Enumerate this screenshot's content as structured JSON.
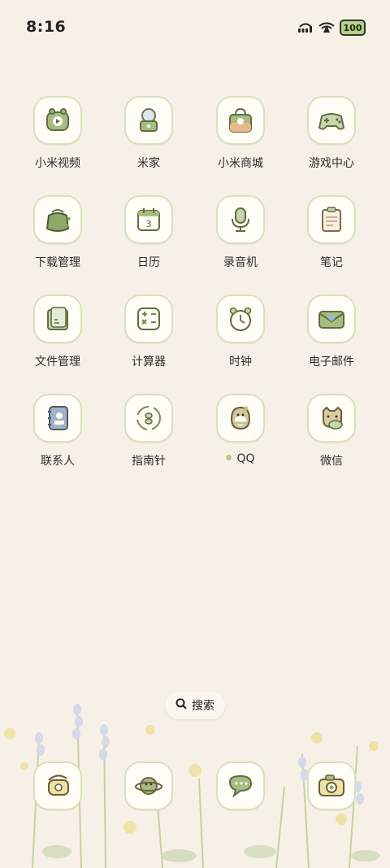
{
  "status_bar": {
    "time": "8:16",
    "battery": "100",
    "icons": [
      "signal-icon",
      "wifi-icon",
      "battery-icon"
    ]
  },
  "apps": [
    {
      "label": "小米视频",
      "icon": "video-icon"
    },
    {
      "label": "米家",
      "icon": "mijia-icon"
    },
    {
      "label": "小米商城",
      "icon": "store-bag-icon"
    },
    {
      "label": "游戏中心",
      "icon": "gamepad-icon"
    },
    {
      "label": "下载管理",
      "icon": "download-bag-icon"
    },
    {
      "label": "日历",
      "icon": "calendar-icon",
      "calendar_number": "3"
    },
    {
      "label": "录音机",
      "icon": "microphone-icon"
    },
    {
      "label": "笔记",
      "icon": "notepad-icon"
    },
    {
      "label": "文件管理",
      "icon": "folder-icon"
    },
    {
      "label": "计算器",
      "icon": "calculator-icon"
    },
    {
      "label": "时钟",
      "icon": "clock-icon"
    },
    {
      "label": "电子邮件",
      "icon": "mail-envelope-icon"
    },
    {
      "label": "联系人",
      "icon": "contacts-book-icon"
    },
    {
      "label": "指南针",
      "icon": "compass-icon"
    },
    {
      "label": "QQ",
      "icon": "qq-penguin-icon",
      "has_new_dot": true
    },
    {
      "label": "微信",
      "icon": "wechat-icon"
    }
  ],
  "search": {
    "label": "搜索",
    "icon": "search-icon"
  },
  "dock": [
    {
      "icon": "phone-icon"
    },
    {
      "icon": "browser-planet-icon"
    },
    {
      "icon": "messages-bubble-icon"
    },
    {
      "icon": "camera-icon"
    }
  ],
  "colors": {
    "background": "#f7f0e6",
    "icon_border": "#d7e0bf",
    "accent_green": "#8fa86a",
    "dot": "#b8c88a"
  }
}
